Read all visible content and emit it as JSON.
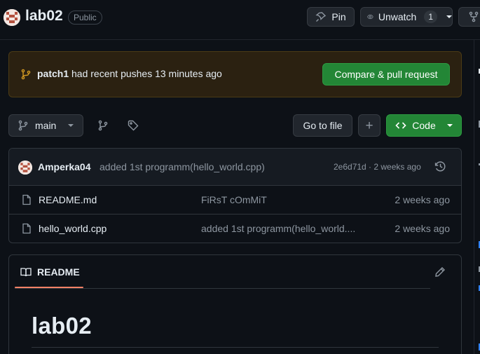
{
  "repo": {
    "name": "lab02",
    "visibility": "Public"
  },
  "header": {
    "pin_label": "Pin",
    "unwatch_label": "Unwatch",
    "watch_count": "1"
  },
  "banner": {
    "branch": "patch1",
    "message": "had recent pushes 13 minutes ago",
    "compare_label": "Compare & pull request"
  },
  "toolbar": {
    "branch": "main",
    "goto_file_label": "Go to file",
    "add_label": "+",
    "code_label": "Code"
  },
  "latest_commit": {
    "author": "Amperka04",
    "message": "added 1st programm(hello_world.cpp)",
    "meta": "2e6d71d · 2 weeks ago"
  },
  "files": [
    {
      "name": "README.md",
      "commit": "FiRsT cOmMiT",
      "age": "2 weeks ago"
    },
    {
      "name": "hello_world.cpp",
      "commit": "added 1st programm(hello_world....",
      "age": "2 weeks ago"
    }
  ],
  "readme": {
    "tab_label": "README",
    "heading": "lab02"
  },
  "colors": {
    "background": "#0d1117",
    "border": "#30363d",
    "green": "#238636",
    "banner_bg": "#2b2111",
    "banner_border": "#4b3b15",
    "accent_underline": "#f78166",
    "link": "#2f81f7"
  }
}
